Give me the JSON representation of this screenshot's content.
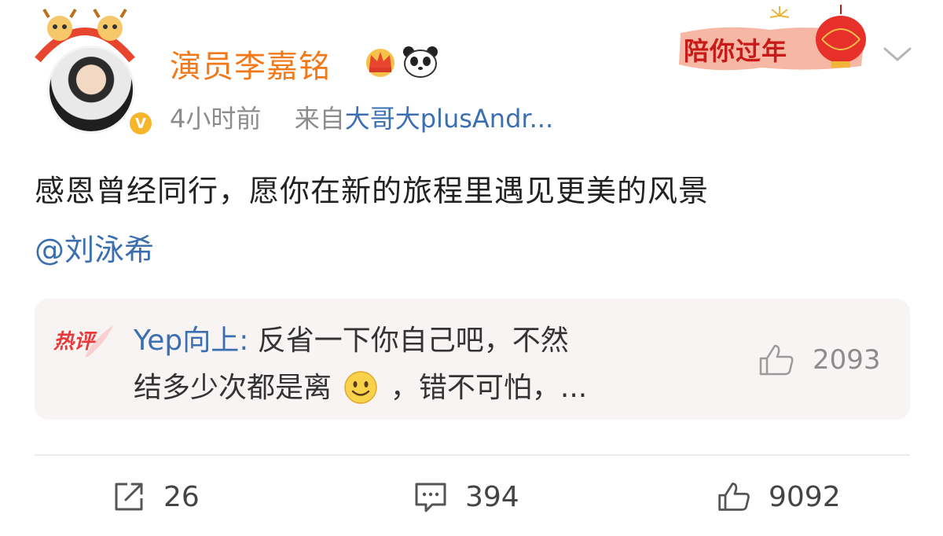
{
  "post": {
    "username": "演员李嘉铭",
    "time": "4小时前",
    "source_prefix": "来自",
    "source_app": "大哥大plusAndr...",
    "text": "感恩曾经同行，愿你在新的旅程里遇见更美的风景",
    "mention": "@刘泳希"
  },
  "banner": {
    "text": "陪你过年"
  },
  "hot_comment": {
    "badge": "热评",
    "author": "Yep向上:",
    "line1": "反省一下你自己吧，不然",
    "line2_before_emoji": "结多少次都是离",
    "line2_after_emoji": "，错不可怕，...",
    "likes": "2093"
  },
  "actions": {
    "reposts": "26",
    "comments": "394",
    "likes": "9092"
  },
  "colors": {
    "username": "#f07a1a",
    "link": "#3b6fb0",
    "meta": "#8c8c8c",
    "hot_badge": "#e83a3a",
    "comment_bg": "#f7f4f3"
  }
}
